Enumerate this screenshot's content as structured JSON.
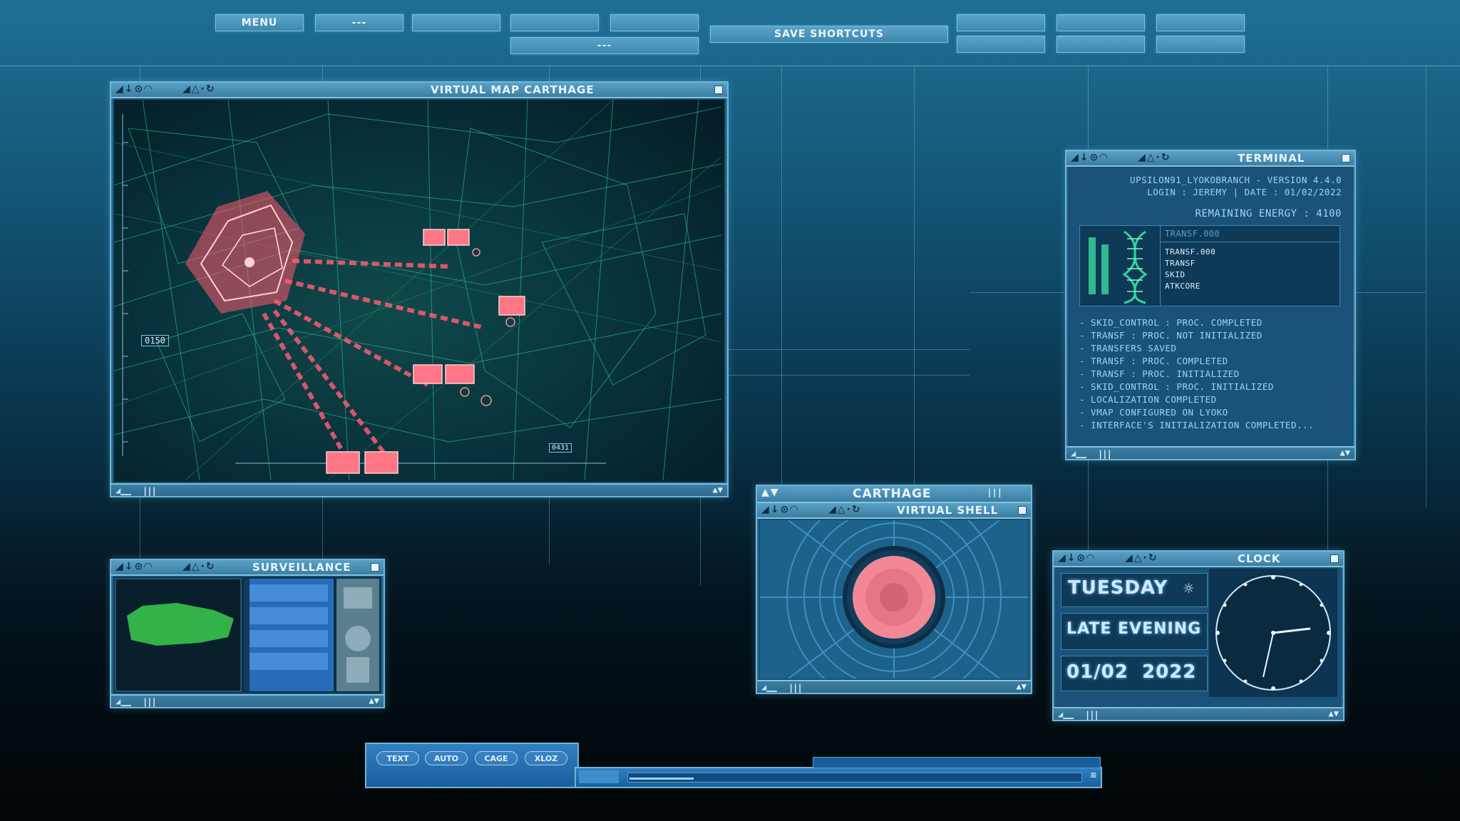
{
  "top_menu": {
    "menu_label": "MENU",
    "dash_label_1": "---",
    "dash_label_2": "---",
    "save_shortcuts_label": "SAVE SHORTCUTS"
  },
  "map_window": {
    "title": "VIRTUAL MAP CARTHAGE",
    "marker_left": "0150",
    "marker_bottom": "0431"
  },
  "terminal": {
    "title": "TERMINAL",
    "version_line": "UPSILON91_LYOKOBRANCH - VERSION 4.4.0",
    "login_line": "LOGIN : JEREMY | DATE : 01/02/2022",
    "energy_line": "REMAINING ENERGY : 4100",
    "list_header": "TRANSF.000",
    "list_items": [
      "TRANSF.000",
      "TRANSF",
      "SKID",
      "ATKCORE"
    ],
    "log": [
      "- SKID_CONTROL : PROC. COMPLETED",
      "- TRANSF : PROC. NOT INITIALIZED",
      "- TRANSFERS SAVED",
      "- TRANSF : PROC. COMPLETED",
      "- TRANSF : PROC. INITIALIZED",
      "- SKID_CONTROL : PROC. INITIALIZED",
      "- LOCALIZATION COMPLETED",
      "- VMAP CONFIGURED ON LYOKO",
      "- INTERFACE'S INITIALIZATION COMPLETED..."
    ]
  },
  "surveillance": {
    "title": "SURVEILLANCE"
  },
  "shell": {
    "header": "CARTHAGE",
    "title": "VIRTUAL SHELL"
  },
  "clock": {
    "title": "CLOCK",
    "day": "TUESDAY",
    "period": "LATE EVENING",
    "date": "01/02",
    "year": "2022"
  },
  "bottom_bar": {
    "buttons": [
      "TEXT",
      "AUTO",
      "CAGE",
      "XLOZ"
    ]
  },
  "colors": {
    "accent": "#6fb5d8",
    "map_grid": "#2fd39a",
    "threat": "#ff5a6e"
  }
}
